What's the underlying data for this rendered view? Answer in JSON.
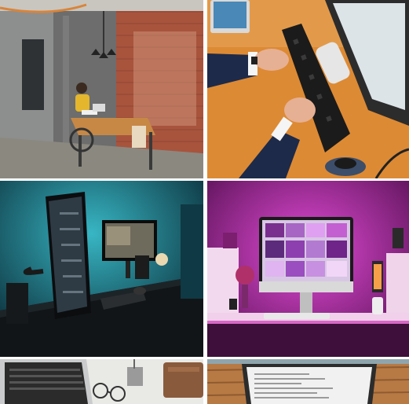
{
  "gallery": {
    "tiles": [
      {
        "subject": "office-brick-wall-wheelchair-desk"
      },
      {
        "subject": "hands-typing-keyboard-orange-desk"
      },
      {
        "subject": "teal-lit-monitor-setup"
      },
      {
        "subject": "magenta-lit-imac-setup"
      },
      {
        "subject": "laptop-glasses-white-desk"
      },
      {
        "subject": "laptop-wooden-table"
      }
    ]
  },
  "colors": {
    "brick": "#a8543d",
    "orange_desk": "#dd8a34",
    "teal": "#1f8fa0",
    "magenta": "#c02ab8",
    "wood": "#b77a45"
  }
}
